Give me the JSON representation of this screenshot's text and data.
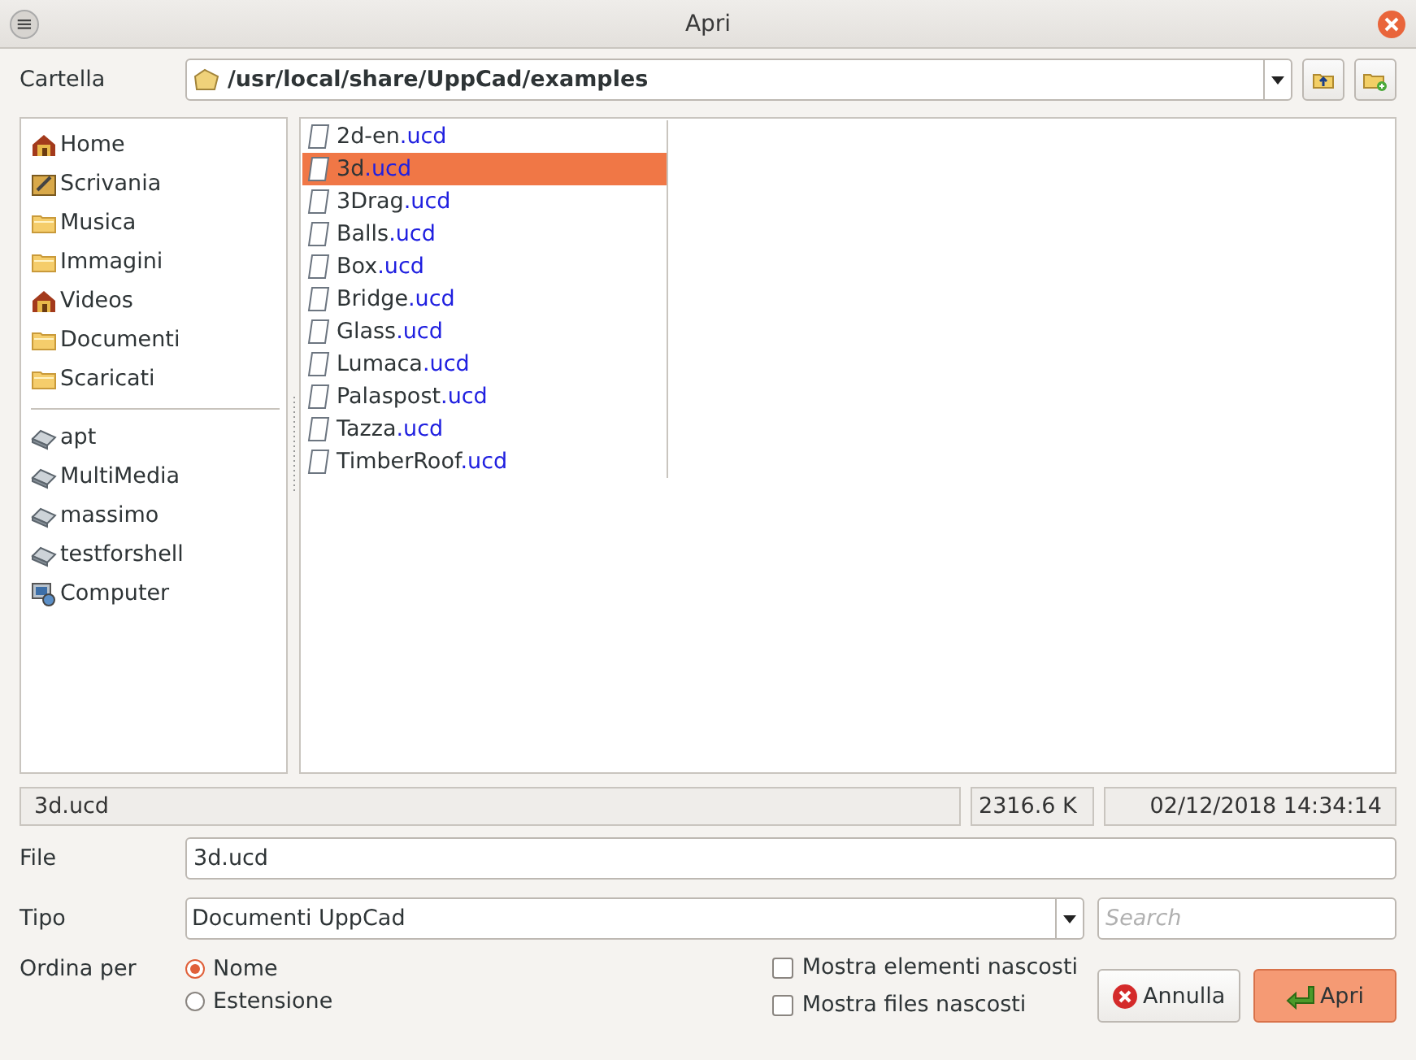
{
  "window": {
    "title": "Apri",
    "menu_icon": "≡"
  },
  "folder": {
    "label": "Cartella",
    "path": "/usr/local/share/UppCad/examples"
  },
  "places": [
    [
      {
        "name": "Home",
        "kind": "home"
      },
      {
        "name": "Scrivania",
        "kind": "desk"
      },
      {
        "name": "Musica",
        "kind": "folder"
      },
      {
        "name": "Immagini",
        "kind": "folder"
      },
      {
        "name": "Videos",
        "kind": "home"
      },
      {
        "name": "Documenti",
        "kind": "folder"
      },
      {
        "name": "Scaricati",
        "kind": "folder"
      }
    ],
    [
      {
        "name": "apt",
        "kind": "drive"
      },
      {
        "name": "MultiMedia",
        "kind": "drive"
      },
      {
        "name": "massimo",
        "kind": "drive"
      },
      {
        "name": "testforshell",
        "kind": "drive"
      },
      {
        "name": "Computer",
        "kind": "computer"
      }
    ]
  ],
  "files": [
    {
      "name": "2d-en",
      "ext": ".ucd",
      "selected": false
    },
    {
      "name": "3d",
      "ext": ".ucd",
      "selected": true
    },
    {
      "name": "3Drag",
      "ext": ".ucd",
      "selected": false
    },
    {
      "name": "Balls",
      "ext": ".ucd",
      "selected": false
    },
    {
      "name": "Box",
      "ext": ".ucd",
      "selected": false
    },
    {
      "name": "Bridge",
      "ext": ".ucd",
      "selected": false
    },
    {
      "name": "Glass",
      "ext": ".ucd",
      "selected": false
    },
    {
      "name": "Lumaca",
      "ext": ".ucd",
      "selected": false
    },
    {
      "name": "Palaspost",
      "ext": ".ucd",
      "selected": false
    },
    {
      "name": "Tazza",
      "ext": ".ucd",
      "selected": false
    },
    {
      "name": "TimberRoof",
      "ext": ".ucd",
      "selected": false
    }
  ],
  "status": {
    "name": "3d.ucd",
    "size": "2316.6 K",
    "date": "02/12/2018 14:34:14"
  },
  "file_field": {
    "label": "File",
    "value": "3d.ucd"
  },
  "type_field": {
    "label": "Tipo",
    "value": "Documenti UppCad"
  },
  "search": {
    "placeholder": "Search"
  },
  "sort": {
    "label": "Ordina per",
    "options": [
      {
        "label": "Nome",
        "selected": true
      },
      {
        "label": "Estensione",
        "selected": false
      }
    ]
  },
  "options": [
    {
      "label": "Mostra elementi nascosti",
      "checked": false
    },
    {
      "label": "Mostra files nascosti",
      "checked": false
    }
  ],
  "buttons": [
    {
      "label": "Annulla",
      "kind": "cancel"
    },
    {
      "label": "Apri",
      "kind": "ok"
    }
  ]
}
